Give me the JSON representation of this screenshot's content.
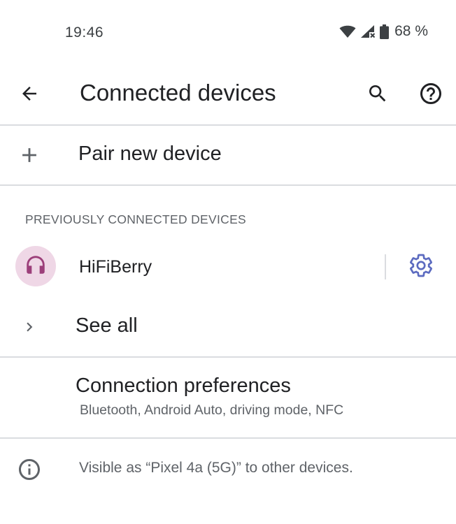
{
  "status_bar": {
    "time": "19:46",
    "battery": "68 %"
  },
  "app_bar": {
    "title": "Connected devices"
  },
  "pair_new": {
    "label": "Pair new device"
  },
  "previously_connected": {
    "header": "PREVIOUSLY CONNECTED DEVICES",
    "devices": [
      {
        "name": "HiFiBerry",
        "icon": "headphones-icon"
      }
    ]
  },
  "see_all": {
    "label": "See all"
  },
  "connection_preferences": {
    "title": "Connection preferences",
    "subtitle": "Bluetooth, Android Auto, driving mode, NFC"
  },
  "footer": {
    "visible_as": "Visible as “Pixel 4a (5G)” to other devices."
  },
  "colors": {
    "accent": "#5c6bc0",
    "avatar_bg": "#efd7e6",
    "headphones": "#9c3f7a",
    "divider": "#dadce0",
    "secondary_text": "#5f6368"
  }
}
